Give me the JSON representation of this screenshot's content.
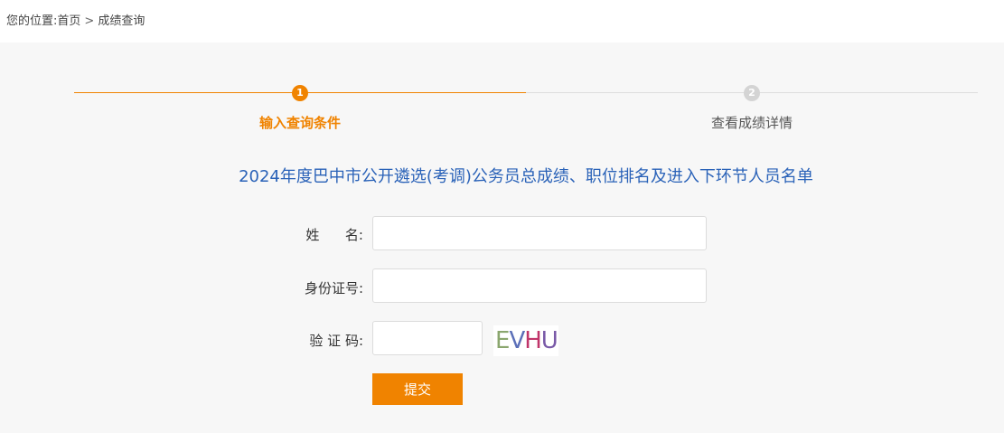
{
  "breadcrumb": {
    "prefix": "您的位置:",
    "home": "首页",
    "separator": ">",
    "current": "成绩查询"
  },
  "stepper": {
    "steps": [
      {
        "number": "1",
        "label": "输入查询条件",
        "active": true
      },
      {
        "number": "2",
        "label": "查看成绩详情",
        "active": false
      }
    ]
  },
  "form": {
    "title": "2024年度巴中市公开遴选(考调)公务员总成绩、职位排名及进入下环节人员名单",
    "name_label": "姓      名:",
    "name_value": "",
    "id_label": "身份证号:",
    "id_value": "",
    "captcha_label": "验 证 码:",
    "captcha_value": "",
    "captcha_chars": [
      "E",
      "V",
      "H",
      "U"
    ],
    "submit_label": "提交"
  },
  "colors": {
    "accent": "#f08300",
    "title_blue": "#2a62b8",
    "inactive_step": "#d4d4d4",
    "panel_bg": "#f7f7f7"
  }
}
